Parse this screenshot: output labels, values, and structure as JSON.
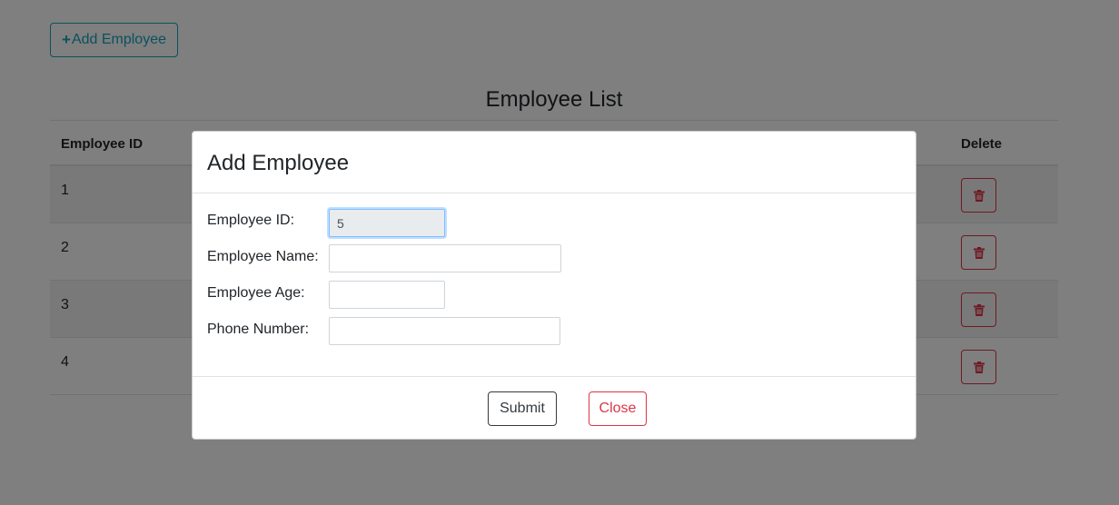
{
  "toolbar": {
    "add_label": "Add Employee",
    "add_icon": "plus-icon"
  },
  "list": {
    "title": "Employee List",
    "columns": {
      "id": "Employee ID",
      "delete": "Delete"
    },
    "rows": [
      {
        "id": "1"
      },
      {
        "id": "2"
      },
      {
        "id": "3"
      },
      {
        "id": "4"
      }
    ],
    "delete_icon": "trash-icon"
  },
  "modal": {
    "title": "Add Employee",
    "fields": {
      "id": {
        "label": "Employee ID:",
        "value": "5"
      },
      "name": {
        "label": "Employee Name:",
        "value": ""
      },
      "age": {
        "label": "Employee Age:",
        "value": ""
      },
      "phone": {
        "label": "Phone Number:",
        "value": ""
      }
    },
    "submit_label": "Submit",
    "close_label": "Close"
  },
  "colors": {
    "info": "#17a2b8",
    "danger": "#dc3545",
    "dark": "#343a40",
    "backdrop": "rgba(0,0,0,0.5)"
  }
}
